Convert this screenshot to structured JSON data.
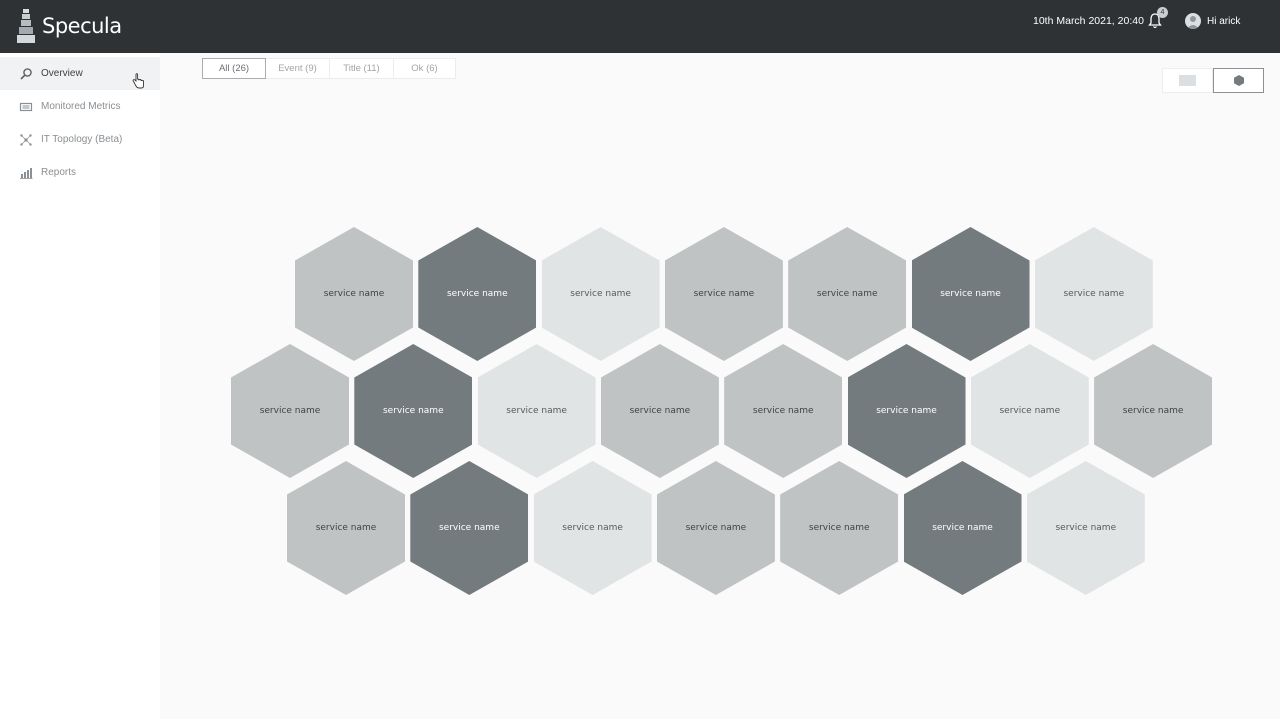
{
  "app": {
    "name": "Specula"
  },
  "header": {
    "datetime": "10th March 2021, 20:40",
    "notification_count": "4",
    "greeting": "Hi arick"
  },
  "sidebar": {
    "items": [
      {
        "label": "Overview",
        "icon": "search-icon",
        "active": true
      },
      {
        "label": "Monitored Metrics",
        "icon": "metrics-icon",
        "active": false
      },
      {
        "label": "IT Topology (Beta)",
        "icon": "topology-icon",
        "active": false
      },
      {
        "label": "Reports",
        "icon": "reports-icon",
        "active": false
      }
    ]
  },
  "filters": [
    {
      "label": "All (26)",
      "active": true
    },
    {
      "label": "Event (9)",
      "active": false
    },
    {
      "label": "Title (11)",
      "active": false
    },
    {
      "label": "Ok (6)",
      "active": false
    }
  ],
  "view_toggle": {
    "options": [
      "grid-view-icon",
      "hex-view-icon"
    ],
    "selected": "hex-view-icon"
  },
  "colors": {
    "light": "#e1e4e5",
    "medium": "#bfc3c4",
    "dark": "#747b7e",
    "header_bg": "#2e3235"
  },
  "services": {
    "rows": [
      [
        "medium",
        "dark",
        "light",
        "medium",
        "medium",
        "dark",
        "light"
      ],
      [
        "medium",
        "dark",
        "light",
        "medium",
        "medium",
        "dark",
        "light",
        "medium"
      ],
      [
        "medium",
        "dark",
        "light",
        "medium",
        "medium",
        "dark",
        "light"
      ]
    ],
    "label": "service name"
  }
}
